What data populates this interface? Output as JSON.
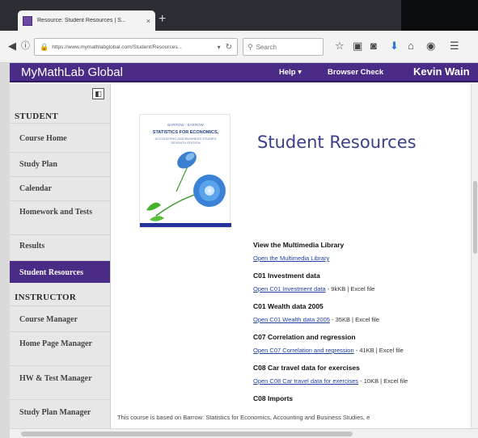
{
  "browser": {
    "tab_title": "Resource: Student Resources | S...",
    "tab_close": "×",
    "new_tab": "+",
    "url": "https://www.mymathlabglobal.com/Student/Resources...",
    "search_placeholder": "Search"
  },
  "header": {
    "brand": "MyMathLab Global",
    "help": "Help ▾",
    "browser_check": "Browser Check",
    "user": "Kevin Wain"
  },
  "sidebar": {
    "student_heading": "STUDENT",
    "student_items": [
      {
        "label": "Course Home"
      },
      {
        "label": "Study Plan"
      },
      {
        "label": "Calendar"
      },
      {
        "label": "Homework and Tests"
      },
      {
        "label": "Results"
      },
      {
        "label": "Student Resources"
      }
    ],
    "instructor_heading": "INSTRUCTOR",
    "instructor_items": [
      {
        "label": "Course Manager"
      },
      {
        "label": "Home Page Manager"
      },
      {
        "label": "HW & Test Manager"
      },
      {
        "label": "Study Plan Manager"
      }
    ]
  },
  "main": {
    "book": {
      "author": "BARROW · BARROW",
      "title": "STATISTICS FOR ECONOMICS,",
      "subtitle": "ACCOUNTING AND BUSINESS STUDIES SEVENTH EDITION"
    },
    "page_title": "Student Resources",
    "resources": [
      {
        "title": "View the Multimedia Library",
        "link": "Open the Multimedia Library",
        "meta": ""
      },
      {
        "title": "C01 Investment data",
        "link": "Open C01 Investment data",
        "meta": " - 9kKB | Excel file"
      },
      {
        "title": "C01 Wealth data 2005",
        "link": "Open C01 Wealth data 2005",
        "meta": " - 35KB | Excel file"
      },
      {
        "title": "C07 Correlation and regression",
        "link": "Open C07 Correlation and regression",
        "meta": " - 41KB | Excel file"
      },
      {
        "title": "C08 Car travel data for exercises",
        "link": "Open C08 Car travel data for exercises",
        "meta": " - 10KB | Excel file"
      },
      {
        "title": "C08 Imports",
        "link": "",
        "meta": ""
      }
    ],
    "footer_note": "This course is based on Barrow: Statistics for Economics, Accounting and Business Studies, e"
  }
}
